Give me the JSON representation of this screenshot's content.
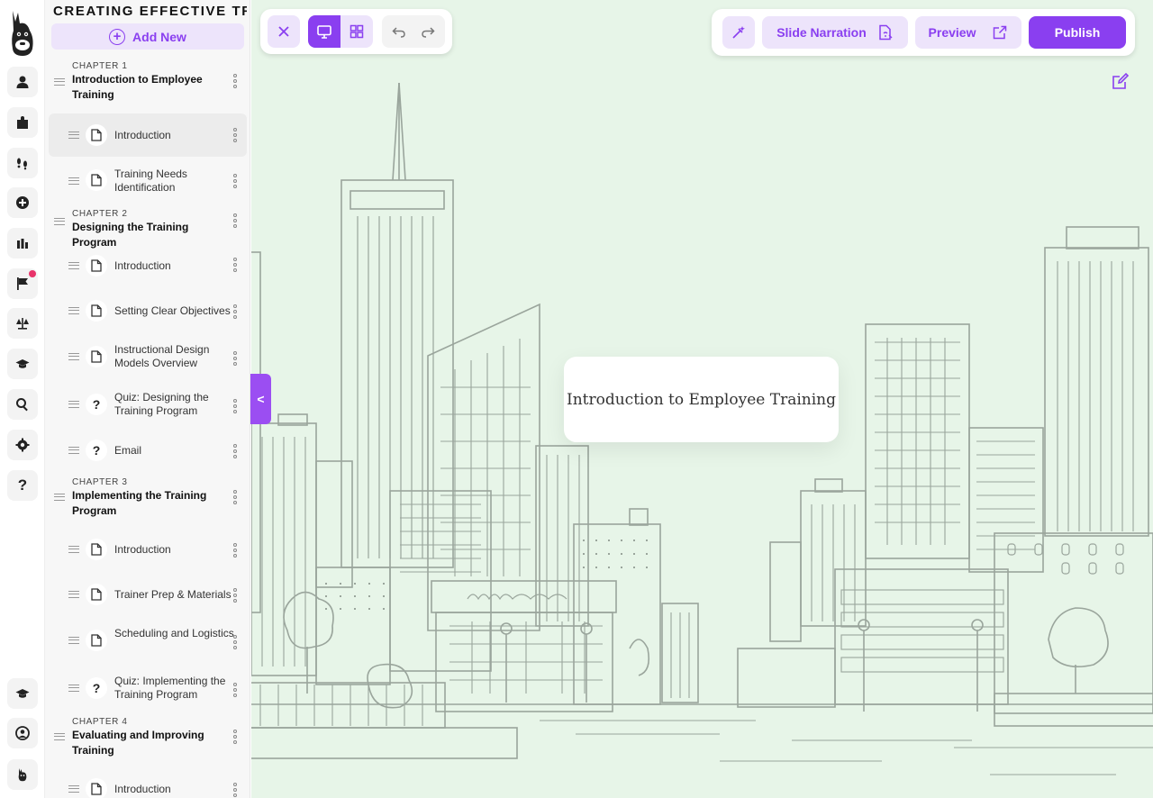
{
  "course": {
    "title": "CREATING EFFECTIVE TRAINING",
    "add_new_label": "Add New"
  },
  "chapters": [
    {
      "label": "CHAPTER 1",
      "title": "Introduction to Employee Training",
      "lessons": [
        {
          "title": "Introduction",
          "type": "page",
          "active": true
        },
        {
          "title": "Training Needs Identification",
          "type": "page"
        }
      ]
    },
    {
      "label": "CHAPTER 2",
      "title": "Designing the Training Program",
      "lessons": [
        {
          "title": "Introduction",
          "type": "page"
        },
        {
          "title": "Setting Clear Objectives",
          "type": "page"
        },
        {
          "title": "Instructional Design Models Overview",
          "type": "page"
        },
        {
          "title": "Quiz: Designing the Training Program",
          "type": "quiz"
        },
        {
          "title": "Email",
          "type": "quiz"
        }
      ]
    },
    {
      "label": "CHAPTER 3",
      "title": "Implementing the Training Program",
      "lessons": [
        {
          "title": "Introduction",
          "type": "page"
        },
        {
          "title": "Trainer Prep & Materials",
          "type": "page"
        },
        {
          "title": "Scheduling and Logistics",
          "type": "page"
        },
        {
          "title": "Quiz: Implementing the Training Program",
          "type": "quiz"
        }
      ]
    },
    {
      "label": "CHAPTER 4",
      "title": "Evaluating and Improving Training",
      "lessons": [
        {
          "title": "Introduction",
          "type": "page"
        }
      ]
    }
  ],
  "toolbar": {
    "slide_narration_label": "Slide Narration",
    "preview_label": "Preview",
    "publish_label": "Publish"
  },
  "slide": {
    "title": "Introduction to Employee Training"
  },
  "icons": {
    "rail": [
      "user-icon",
      "puzzle-icon",
      "footprints-icon",
      "plus-circle-icon",
      "bar-chart-icon",
      "flag-icon",
      "scale-icon",
      "graduation-cap-icon",
      "search-icon",
      "gear-icon",
      "help-icon",
      "graduation-cap-icon",
      "face-icon",
      "llama-icon"
    ]
  },
  "colors": {
    "accent": "#8a3ff0",
    "accent_light": "#ede4fb",
    "canvas": "#e7f5e8",
    "notification": "#e8346a"
  }
}
